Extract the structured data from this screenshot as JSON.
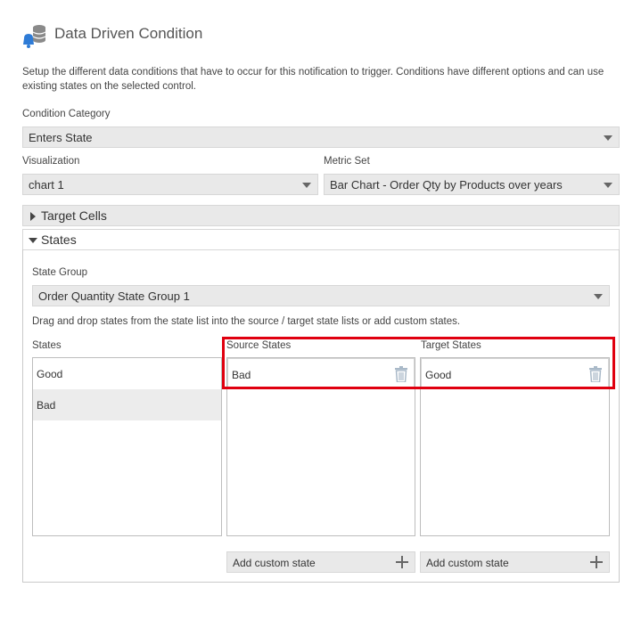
{
  "header": {
    "title": "Data Driven Condition",
    "icon": "database-bell-icon"
  },
  "intro": {
    "text": "Setup the different data conditions that have to occur for this notification to trigger. Conditions have different options and can use existing states on the selected control."
  },
  "condition_category": {
    "label": "Condition Category",
    "value": "Enters State"
  },
  "visualization": {
    "label": "Visualization",
    "value": "chart 1"
  },
  "metric_set": {
    "label": "Metric Set",
    "value": "Bar Chart - Order Qty by Products over years"
  },
  "sections": {
    "target_cells": "Target Cells",
    "states": "States"
  },
  "state_group": {
    "label": "State Group",
    "value": "Order Quantity State Group 1"
  },
  "drag_hint": "Drag and drop states from the state list into the source / target state lists or add custom states.",
  "states_list": {
    "label": "States",
    "items": [
      "Good",
      "Bad"
    ]
  },
  "source_states": {
    "label": "Source States",
    "items": [
      "Bad"
    ],
    "add_label": "Add custom state"
  },
  "target_states": {
    "label": "Target States",
    "items": [
      "Good"
    ],
    "add_label": "Add custom state"
  },
  "colors": {
    "highlight": "#e0000f",
    "accent_blue": "#2e7bd6",
    "trash_icon": "#a9b9c8"
  }
}
